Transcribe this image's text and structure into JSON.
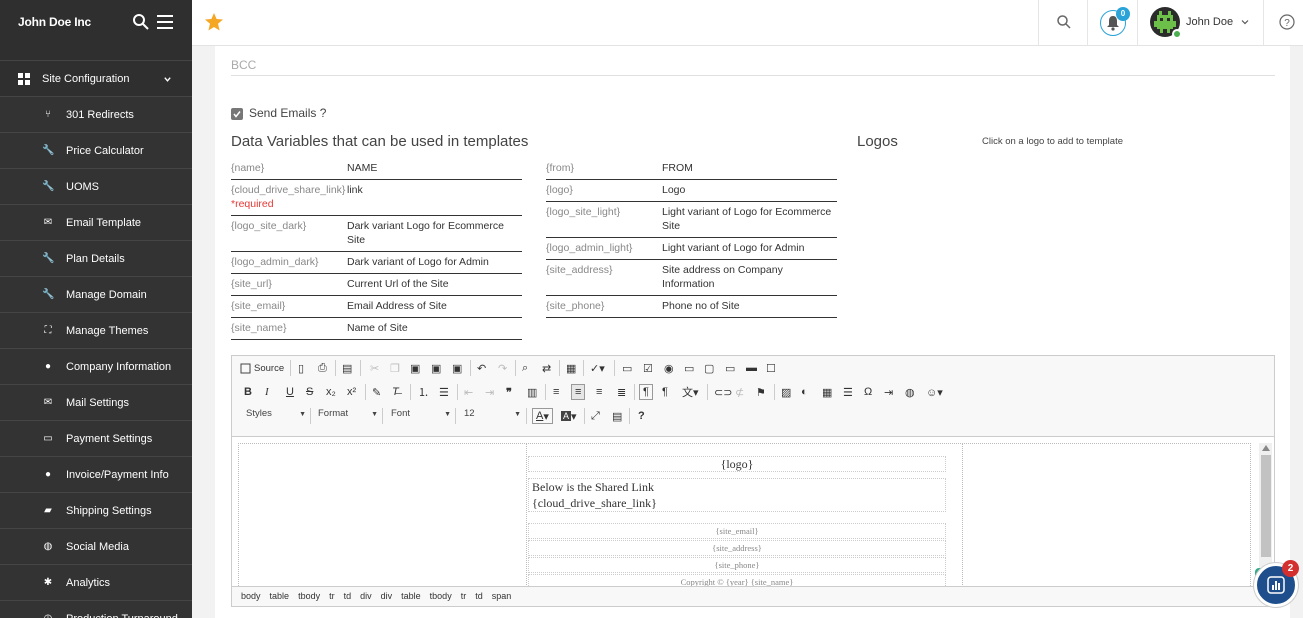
{
  "brand": {
    "name": "John Doe Inc"
  },
  "topbar": {
    "notif_count": "0",
    "user_name": "John Doe"
  },
  "sidebar": {
    "section": "Site Configuration",
    "items": [
      {
        "label": "301 Redirects",
        "icon": "redirect-icon"
      },
      {
        "label": "Price Calculator",
        "icon": "wrench-icon"
      },
      {
        "label": "UOMS",
        "icon": "wrench-icon"
      },
      {
        "label": "Email Template",
        "icon": "envelope-icon"
      },
      {
        "label": "Plan Details",
        "icon": "wrench-icon"
      },
      {
        "label": "Manage Domain",
        "icon": "wrench-icon"
      },
      {
        "label": "Manage Themes",
        "icon": "paint-icon"
      },
      {
        "label": "Company Information",
        "icon": "info-icon"
      },
      {
        "label": "Mail Settings",
        "icon": "envelope-icon"
      },
      {
        "label": "Payment Settings",
        "icon": "card-icon"
      },
      {
        "label": "Invoice/Payment Info",
        "icon": "info-icon"
      },
      {
        "label": "Shipping Settings",
        "icon": "truck-icon"
      },
      {
        "label": "Social Media",
        "icon": "globe-icon"
      },
      {
        "label": "Analytics",
        "icon": "puzzle-icon"
      },
      {
        "label": "Production Turnaround",
        "icon": "clock-icon"
      }
    ]
  },
  "form": {
    "bcc_placeholder": "BCC",
    "send_emails_label": "Send Emails ?",
    "data_vars_title": "Data Variables that can be used in templates",
    "logos_title": "Logos",
    "logos_hint": "Click on a logo to add to template",
    "required_text": "*required"
  },
  "vars_left": [
    {
      "key": "{name}",
      "val": "NAME"
    },
    {
      "key": "{cloud_drive_share_link}",
      "val": "link"
    },
    {
      "key": "{logo_site_dark}",
      "val": "Dark variant Logo for Ecommerce Site"
    },
    {
      "key": "{logo_admin_dark}",
      "val": "Dark variant of Logo for Admin"
    },
    {
      "key": "{site_url}",
      "val": "Current Url of the Site"
    },
    {
      "key": "{site_email}",
      "val": "Email Address of Site"
    },
    {
      "key": "{site_name}",
      "val": "Name of Site"
    }
  ],
  "vars_right": [
    {
      "key": "{from}",
      "val": "FROM"
    },
    {
      "key": "{logo}",
      "val": "Logo"
    },
    {
      "key": "{logo_site_light}",
      "val": "Light variant of Logo for Ecommerce Site"
    },
    {
      "key": "{logo_admin_light}",
      "val": "Light variant of Logo for Admin"
    },
    {
      "key": "{site_address}",
      "val": "Site address on Company Information"
    },
    {
      "key": "{site_phone}",
      "val": "Phone no of Site"
    }
  ],
  "editor": {
    "source_label": "Source",
    "styles_label": "Styles",
    "format_label": "Format",
    "font_label": "Font",
    "size_label": "12",
    "help_label": "?",
    "content": {
      "logo": "{logo}",
      "line1": "Below is the Shared Link",
      "line2": "{cloud_drive_share_link}",
      "email": "{site_email}",
      "address": "{site_address}",
      "phone": "{site_phone}",
      "copyright": "Copyright © {year} {site_name}"
    },
    "path": [
      "body",
      "table",
      "tbody",
      "tr",
      "td",
      "div",
      "div",
      "table",
      "tbody",
      "tr",
      "td",
      "span"
    ]
  },
  "chat_widget": {
    "badge": "2"
  },
  "colors": {
    "sidebar": "#2f2f2f",
    "accent": "#2aa3d8",
    "star": "#f5a623",
    "required": "#e53935"
  }
}
